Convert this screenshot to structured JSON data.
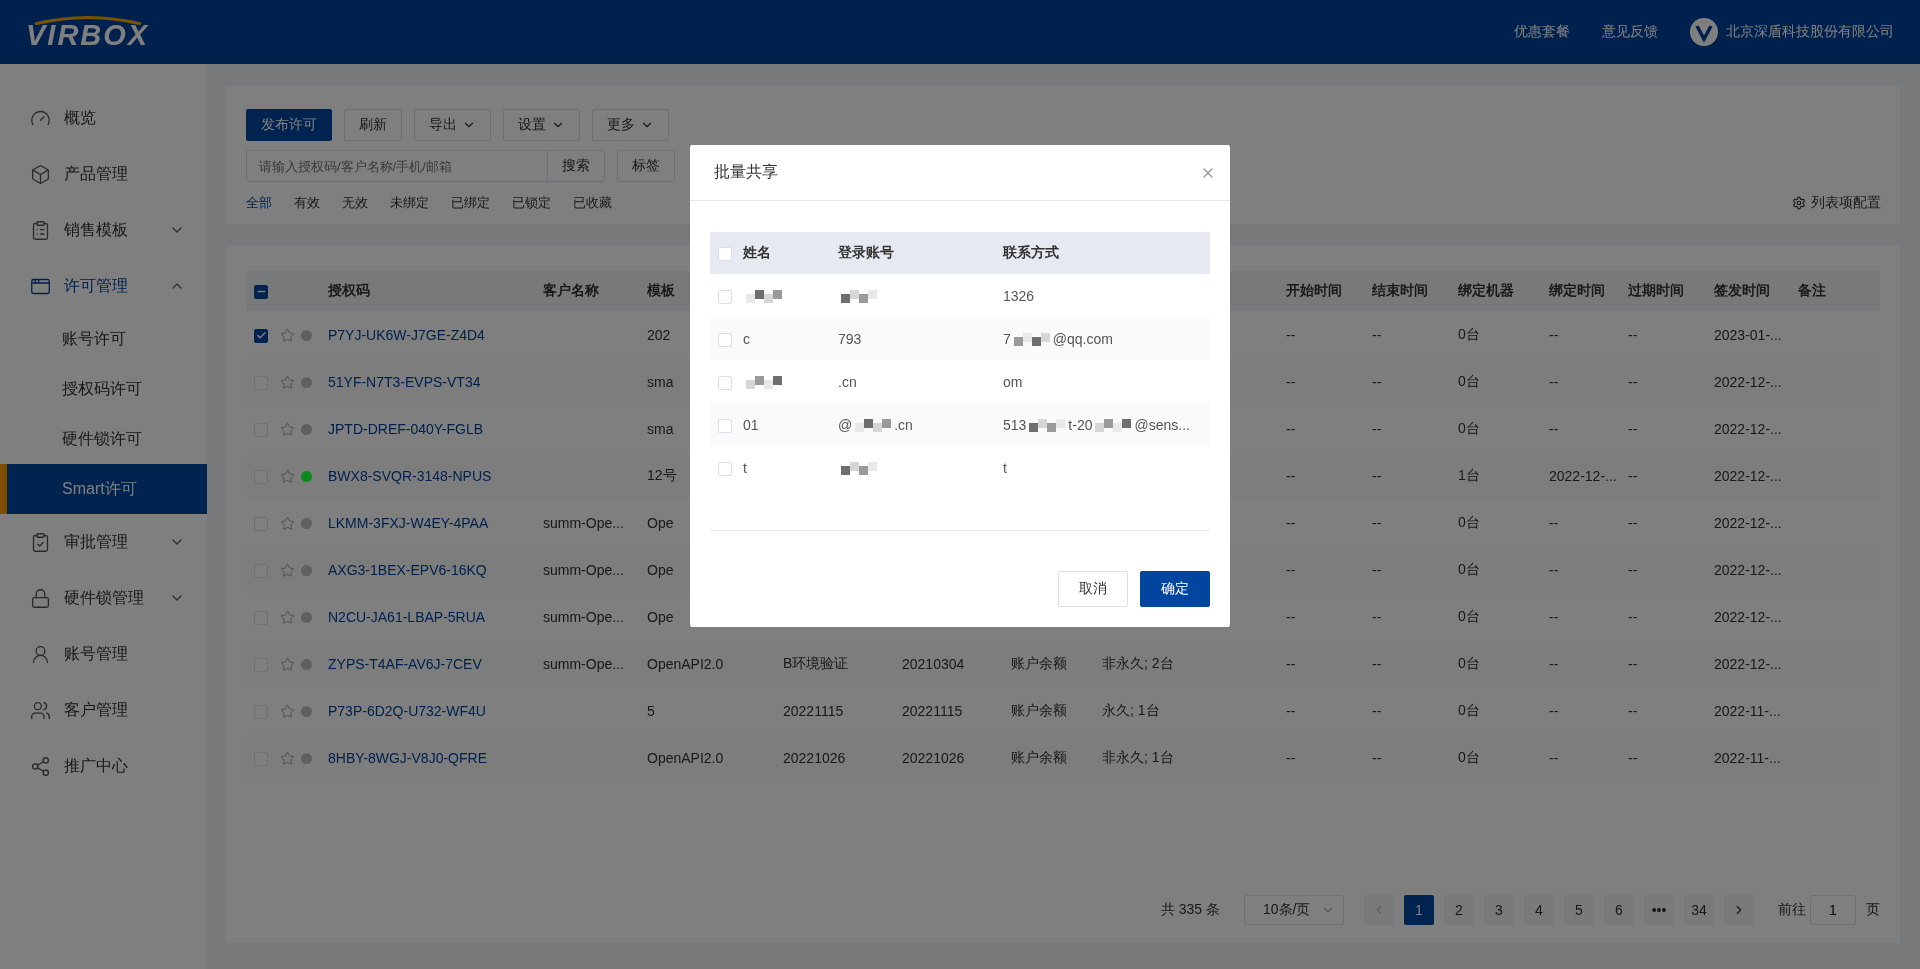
{
  "header": {
    "logo": "VIRBOX",
    "links": [
      "优惠套餐",
      "意见反馈"
    ],
    "company": "北京深盾科技股份有限公司"
  },
  "sidebar": {
    "items": [
      {
        "kind": "gauge",
        "label": "概览",
        "selected": false
      },
      {
        "kind": "box",
        "label": "产品管理",
        "selected": false
      },
      {
        "kind": "list",
        "label": "销售模板",
        "selected": false,
        "expanded": false
      },
      {
        "kind": "window",
        "label": "许可管理",
        "selected": false,
        "expanded": true,
        "children": [
          {
            "label": "账号许可",
            "selected": false
          },
          {
            "label": "授权码许可",
            "selected": false
          },
          {
            "label": "硬件锁许可",
            "selected": false
          },
          {
            "label": "Smart许可",
            "selected": true
          }
        ]
      },
      {
        "kind": "approve",
        "label": "审批管理",
        "selected": false,
        "expanded": false
      },
      {
        "kind": "lock",
        "label": "硬件锁管理",
        "selected": false,
        "expanded": false
      },
      {
        "kind": "user",
        "label": "账号管理",
        "selected": false
      },
      {
        "kind": "users",
        "label": "客户管理",
        "selected": false
      },
      {
        "kind": "share",
        "label": "推广中心",
        "selected": false
      }
    ]
  },
  "toolbar": {
    "buttons": [
      {
        "label": "发布许可",
        "kind": "primary"
      },
      {
        "label": "刷新",
        "kind": "plain"
      },
      {
        "label": "导出",
        "kind": "dropdown"
      },
      {
        "label": "设置",
        "kind": "dropdown"
      },
      {
        "label": "更多",
        "kind": "dropdown"
      }
    ],
    "search": {
      "placeholder": "请输入授权码/客户名称/手机/邮箱",
      "button": "搜索"
    },
    "tag_button": "标签",
    "filters": [
      {
        "label": "全部",
        "selected": true
      },
      {
        "label": "有效",
        "selected": false
      },
      {
        "label": "无效",
        "selected": false
      },
      {
        "label": "未绑定",
        "selected": false
      },
      {
        "label": "已绑定",
        "selected": false
      },
      {
        "label": "已锁定",
        "selected": false
      },
      {
        "label": "已收藏",
        "selected": false
      }
    ],
    "column_config": "列表项配置"
  },
  "table": {
    "header_checkbox": {
      "indeterminate": true
    },
    "columns": [
      "授权码",
      "客户名称",
      "模板",
      null,
      null,
      null,
      null,
      "开始时间",
      "结束时间",
      "绑定机器",
      "绑定时间",
      "过期时间",
      "签发时间",
      "备注"
    ],
    "rows": [
      {
        "checked": true,
        "starred": false,
        "color": "#606060",
        "cells": [
          "P7YJ-UK6W-J7GE-Z4D4",
          null,
          "202",
          null,
          null,
          null,
          null,
          "--",
          "--",
          "0台",
          "--",
          "--",
          "2023-01-..."
        ]
      },
      {
        "checked": false,
        "starred": false,
        "color": "#606060",
        "cells": [
          "51YF-N7T3-EVPS-VT34",
          null,
          "sma",
          null,
          null,
          null,
          null,
          "--",
          "--",
          "0台",
          "--",
          "--",
          "2022-12-..."
        ]
      },
      {
        "checked": false,
        "starred": false,
        "color": "#606060",
        "cells": [
          "JPTD-DREF-040Y-FGLB",
          null,
          "sma",
          null,
          null,
          null,
          null,
          "--",
          "--",
          "0台",
          "--",
          "--",
          "2022-12-..."
        ]
      },
      {
        "checked": false,
        "starred": false,
        "color": "#0a8a1e",
        "cells": [
          "BWX8-SVQR-3148-NPUS",
          null,
          "12号",
          null,
          null,
          null,
          null,
          "--",
          "--",
          "1台",
          "2022-12-...",
          "--",
          "2022-12-..."
        ]
      },
      {
        "checked": false,
        "starred": false,
        "color": "#606060",
        "cells": [
          "LKMM-3FXJ-W4EY-4PAA",
          "summ-Ope...",
          "Ope",
          null,
          null,
          null,
          null,
          "--",
          "--",
          "0台",
          "--",
          "--",
          "2022-12-..."
        ]
      },
      {
        "checked": false,
        "starred": false,
        "color": "#606060",
        "cells": [
          "AXG3-1BEX-EPV6-16KQ",
          "summ-Ope...",
          "Ope",
          null,
          null,
          null,
          null,
          "--",
          "--",
          "0台",
          "--",
          "--",
          "2022-12-..."
        ]
      },
      {
        "checked": false,
        "starred": false,
        "color": "#606060",
        "cells": [
          "N2CU-JA61-LBAP-5RUA",
          "summ-Ope...",
          "Ope",
          null,
          null,
          null,
          null,
          "--",
          "--",
          "0台",
          "--",
          "--",
          "2022-12-..."
        ]
      },
      {
        "checked": false,
        "starred": false,
        "color": "#606060",
        "cells": [
          "ZYPS-T4AF-AV6J-7CEV",
          "summ-Ope...",
          "OpenAPI2.0",
          "B环境验证",
          "20210304",
          "账户余额",
          "非永久; 2台",
          "--",
          "--",
          "0台",
          "--",
          "--",
          "2022-12-..."
        ]
      },
      {
        "checked": false,
        "starred": false,
        "color": "#606060",
        "cells": [
          "P73P-6D2Q-U732-WF4U",
          null,
          "5",
          "20221115",
          "20221115",
          "账户余额",
          "永久; 1台",
          "--",
          "--",
          "0台",
          "--",
          "--",
          "2022-11-..."
        ]
      },
      {
        "checked": false,
        "starred": false,
        "color": "#606060",
        "cells": [
          "8HBY-8WGJ-V8J0-QFRE",
          null,
          "OpenAPI2.0",
          "20221026",
          "20221026",
          "账户余额",
          "非永久; 1台",
          "--",
          "--",
          "0台",
          "--",
          "--",
          "2022-11-..."
        ]
      }
    ]
  },
  "pagination": {
    "total": "共 335 条",
    "page_size": "10条/页",
    "pages": [
      {
        "label": "1",
        "selected": true
      },
      {
        "label": "2",
        "selected": false
      },
      {
        "label": "3",
        "selected": false
      },
      {
        "label": "4",
        "selected": false
      },
      {
        "label": "5",
        "selected": false
      },
      {
        "label": "6",
        "selected": false
      },
      {
        "label": "•••",
        "selected": false
      },
      {
        "label": "34",
        "selected": false
      }
    ],
    "goto_label": "前往",
    "goto_value": "1",
    "goto_suffix": "页"
  },
  "dialog": {
    "title": "批量共享",
    "select_all_checked": false,
    "columns": [
      "姓名",
      "登录账号",
      "联系方式"
    ],
    "rows": [
      {
        "checked": false,
        "cells": [
          [],
          [],
          [
            "1326"
          ]
        ]
      },
      {
        "checked": false,
        "cells": [
          [
            "c"
          ],
          [
            "793"
          ],
          [
            "7",
            "@qq.com"
          ]
        ]
      },
      {
        "checked": false,
        "cells": [
          [],
          [
            ".cn"
          ],
          [
            "om"
          ]
        ]
      },
      {
        "checked": false,
        "cells": [
          [
            "01"
          ],
          [
            "@",
            ".cn"
          ],
          [
            "513",
            "t-20",
            "@sens..."
          ]
        ]
      },
      {
        "checked": false,
        "cells": [
          [
            "t"
          ],
          [],
          [
            "t"
          ]
        ]
      }
    ],
    "buttons": [
      {
        "label": "取消",
        "kind": "plain"
      },
      {
        "label": "确定",
        "kind": "primary"
      }
    ]
  }
}
